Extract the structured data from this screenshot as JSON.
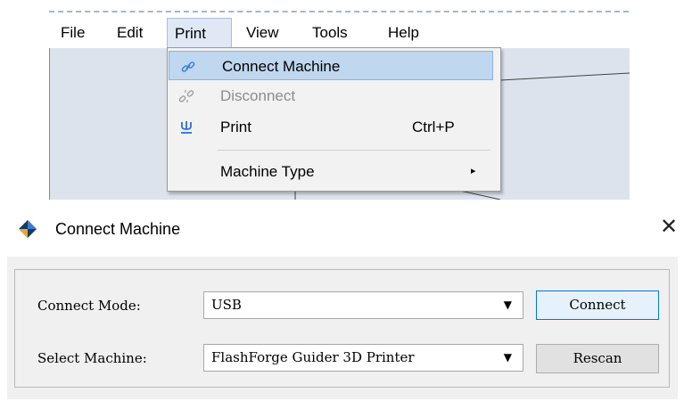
{
  "menubar": {
    "items": [
      {
        "label": "File"
      },
      {
        "label": "Edit"
      },
      {
        "label": "Print"
      },
      {
        "label": "View"
      },
      {
        "label": "Tools"
      },
      {
        "label": "Help"
      }
    ],
    "active_item": "Print"
  },
  "print_menu": {
    "items": [
      {
        "icon": "link-icon",
        "label": "Connect Machine",
        "shortcut": "",
        "state": "highlighted"
      },
      {
        "icon": "broken-link-icon",
        "label": "Disconnect",
        "shortcut": "",
        "state": "disabled"
      },
      {
        "icon": "usb-icon",
        "label": "Print",
        "shortcut": "Ctrl+P",
        "state": "normal"
      },
      {
        "icon": "",
        "label": "Machine Type",
        "shortcut": "",
        "state": "submenu"
      }
    ],
    "submenu_arrow": "▸"
  },
  "dialog": {
    "title": "Connect Machine",
    "icon": "flashforge-logo-icon",
    "close_glyph": "✕",
    "connect_mode_label": "Connect Mode:",
    "connect_mode_value": "USB",
    "select_machine_label": "Select Machine:",
    "select_machine_value": "FlashForge Guider 3D Printer",
    "dropdown_arrow": "▼",
    "connect_button": "Connect",
    "rescan_button": "Rescan"
  },
  "colors": {
    "menu_highlight": "#bfd7ef",
    "canvas_background": "#dde3ec",
    "primary_button_border": "#0078d7",
    "logo_dark": "#1a3a5c",
    "logo_orange": "#e8a63a",
    "logo_blue": "#3b7bd4"
  }
}
